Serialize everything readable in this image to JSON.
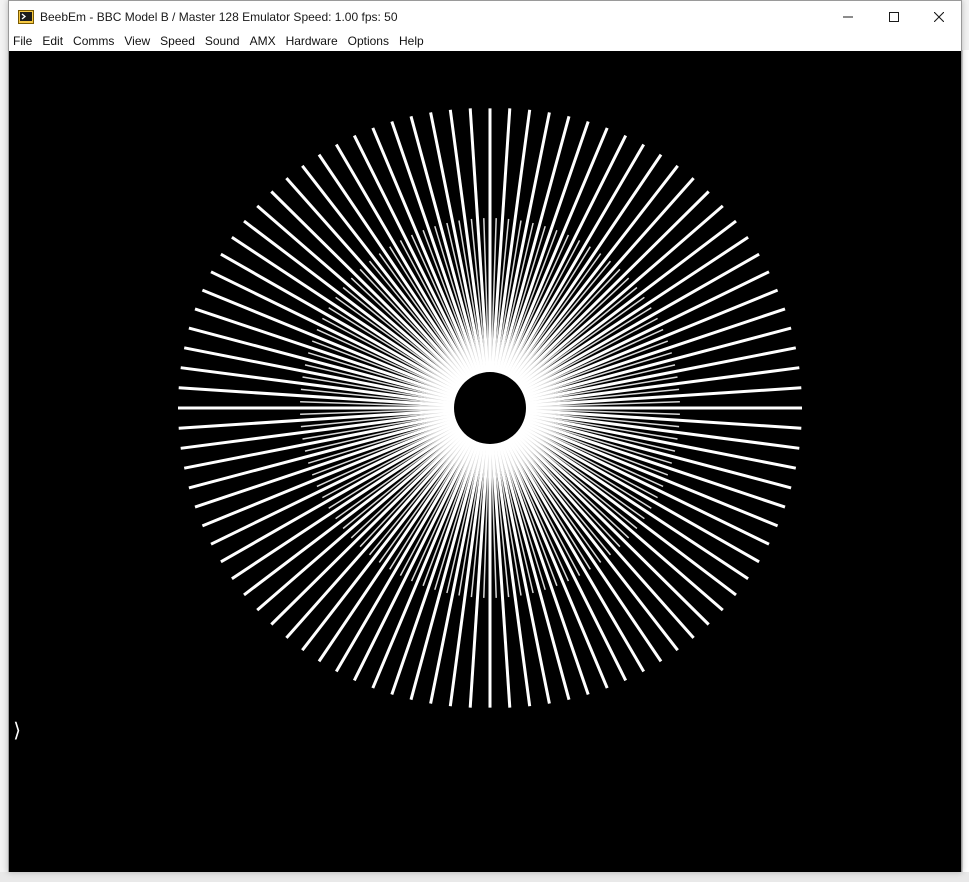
{
  "window": {
    "title": "BeebEm - BBC Model B / Master 128 Emulator  Speed: 1.00  fps: 50",
    "app_icon": "beebem-app-icon"
  },
  "caption_buttons": {
    "minimize_icon": "minimize-icon",
    "maximize_icon": "maximize-icon",
    "close_icon": "close-icon"
  },
  "menu": {
    "items": [
      "File",
      "Edit",
      "Comms",
      "View",
      "Speed",
      "Sound",
      "AMX",
      "Hardware",
      "Options",
      "Help"
    ]
  },
  "screen": {
    "background": "#000000",
    "foreground": "#ffffff",
    "prompt": "⟩"
  }
}
